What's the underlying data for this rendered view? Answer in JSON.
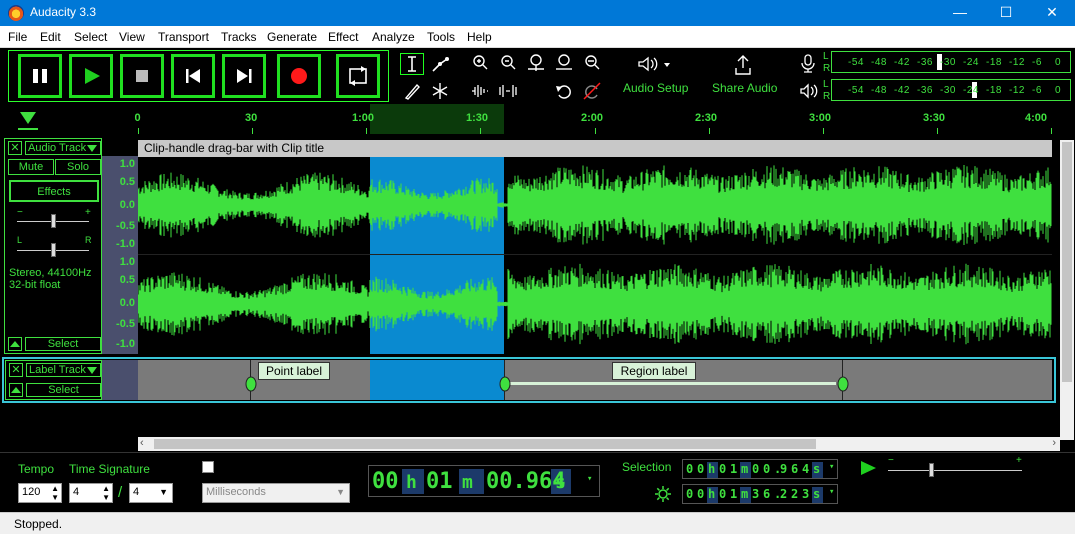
{
  "window": {
    "title": "Audacity 3.3",
    "minimize_glyph": "—",
    "maximize_glyph": "☐",
    "close_glyph": "✕"
  },
  "menu": [
    "File",
    "Edit",
    "Select",
    "View",
    "Transport",
    "Tracks",
    "Generate",
    "Effect",
    "Analyze",
    "Tools",
    "Help"
  ],
  "toolbar": {
    "audio_setup_label": "Audio Setup",
    "share_audio_label": "Share Audio",
    "meter_scale": [
      "-54",
      "-48",
      "-42",
      "-36",
      "-30",
      "-24",
      "-18",
      "-12",
      "-6",
      "0"
    ],
    "meter_scale_play": [
      "-54",
      "-48",
      "-42",
      "-36",
      "-30",
      "-24",
      "-18",
      "-12",
      "-6",
      "0"
    ],
    "record_channels": [
      "L",
      "R"
    ],
    "play_channels": [
      "L",
      "R"
    ]
  },
  "timeline": {
    "ticks": [
      "0",
      "30",
      "1:00",
      "1:30",
      "2:00",
      "2:30",
      "3:00",
      "3:30",
      "4:00"
    ]
  },
  "audio_track": {
    "name": "Audio Track",
    "mute_label": "Mute",
    "solo_label": "Solo",
    "effects_label": "Effects",
    "gain_minus": "−",
    "gain_plus": "+",
    "pan_left": "L",
    "pan_right": "R",
    "info_line1": "Stereo, 44100Hz",
    "info_line2": "32-bit float",
    "select_label": "Select",
    "clip_title": "Clip-handle drag-bar with Clip title",
    "ruler_top": [
      "1.0",
      "0.5",
      "0.0",
      "-0.5",
      "-1.0"
    ],
    "ruler_bottom": [
      "1.0",
      "0.5",
      "0.0",
      "-0.5",
      "-1.0"
    ]
  },
  "label_track": {
    "name": "Label Track",
    "select_label": "Select",
    "point_label": "Point label",
    "region_label": "Region label"
  },
  "bottom": {
    "tempo_label": "Tempo",
    "time_signature_label": "Time Signature",
    "tempo_value": "120",
    "ts_numerator": "4",
    "ts_slash": "/",
    "ts_denominator": "4",
    "snap_unit": "Milliseconds",
    "selection_label": "Selection",
    "time_h": "00",
    "time_h_unit": "h",
    "time_m": "01",
    "time_m_unit": "m",
    "time_s": "00.964",
    "time_s_unit": "s",
    "sel_start": [
      "0",
      "0",
      "h",
      "0",
      "1",
      "m",
      "0",
      "0",
      ".",
      "9",
      "6",
      "4",
      "s"
    ],
    "sel_end": [
      "0",
      "0",
      "h",
      "0",
      "1",
      "m",
      "3",
      "6",
      ".",
      "2",
      "2",
      "3",
      "s"
    ],
    "play_speed_minus": "−",
    "play_speed_plus": "+"
  },
  "status": {
    "text": "Stopped."
  },
  "colors": {
    "accent_green": "#3fe03f",
    "selection_blue": "#0a8ad0",
    "titlebar_blue": "#0078d7",
    "record_red": "#ff1a1a"
  }
}
